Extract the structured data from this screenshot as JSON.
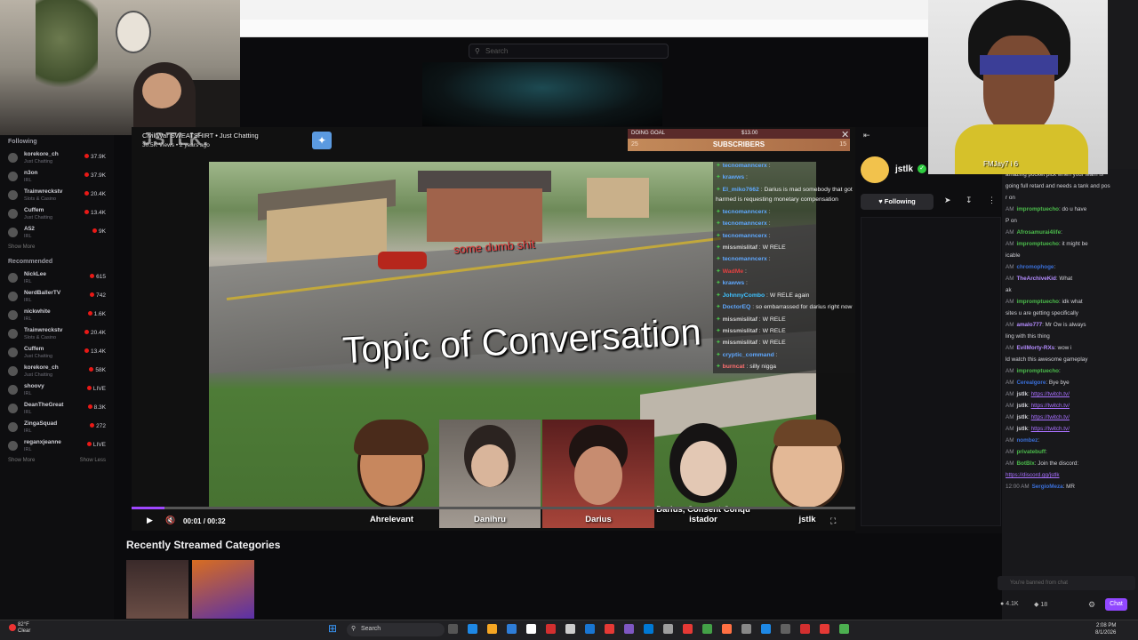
{
  "browser": {
    "search_placeholder": "Search"
  },
  "sidebar": {
    "following_header": "Following",
    "following": [
      {
        "name": "korekore_ch",
        "game": "Just Chatting",
        "count": "37.9K"
      },
      {
        "name": "n3on",
        "game": "IRL",
        "count": "37.9K"
      },
      {
        "name": "Trainwreckstv",
        "game": "Slots & Casino",
        "count": "20.4K"
      },
      {
        "name": "Cuffem",
        "game": "Just Chatting",
        "count": "13.4K"
      },
      {
        "name": "A52",
        "game": "IRL",
        "count": "9K"
      }
    ],
    "show_more": "Show More",
    "recommended_header": "Recommended",
    "recommended": [
      {
        "name": "NickLee",
        "game": "IRL",
        "count": "615"
      },
      {
        "name": "NerdBallerTV",
        "game": "IRL",
        "count": "742"
      },
      {
        "name": "nickwhite",
        "game": "IRL",
        "count": "1.6K"
      },
      {
        "name": "Trainwreckstv",
        "game": "Slots & Casino",
        "count": "20.4K"
      },
      {
        "name": "Cuffem",
        "game": "Just Chatting",
        "count": "13.4K"
      },
      {
        "name": "korekore_ch",
        "game": "Just Chatting",
        "count": "58K"
      },
      {
        "name": "shoovy",
        "game": "IRL",
        "count": "LIVE"
      },
      {
        "name": "DeanTheGreat",
        "game": "IRL",
        "count": "8.3K"
      },
      {
        "name": "ZingaSquad",
        "game": "IRL",
        "count": "272"
      },
      {
        "name": "reganxjeanne",
        "game": "IRL",
        "count": "LIVE"
      }
    ],
    "show_more_2": "Show More",
    "show_less": "Show Less"
  },
  "player": {
    "stream_title": "Civil War SWEATSHIRT • Just Chatting",
    "stream_views": "30.5K Views • 2 years ago",
    "watermark": "JSTLK.",
    "video_title": "Topic of Conversation",
    "video_subtitle": "some dumb shit",
    "elapsed": "00:01",
    "duration": "00:32",
    "progress": 0.045,
    "goal": {
      "label": "DOING GOAL",
      "amount": "$13.00",
      "bar": "SUBSCRIBERS",
      "left": "25",
      "right": "15"
    },
    "tiles": [
      {
        "label": "Ahrelevant"
      },
      {
        "label": "Danihru"
      },
      {
        "label": "Darius"
      },
      {
        "label": "Darius, Consent Conqu istador"
      },
      {
        "label": "jstlk"
      }
    ]
  },
  "overlay_chat": [
    {
      "user": "tecnomanncerx",
      "text": "",
      "color": "#5fa8ff"
    },
    {
      "user": "krawws",
      "text": "",
      "color": "#5fa8ff"
    },
    {
      "user": "El_miko7662",
      "text": "Darius is mad somebody that got harmed is requesting monetary compensation",
      "color": "#5fa8ff",
      "wrap": true
    },
    {
      "user": "tecnomanncerx",
      "text": "",
      "color": "#5fa8ff"
    },
    {
      "user": "tecnomanncerx",
      "text": "",
      "color": "#5fa8ff"
    },
    {
      "user": "tecnomanncerx",
      "text": "",
      "color": "#5fa8ff"
    },
    {
      "user": "missmislitaf",
      "text": "W RELE",
      "color": "#d0d0d0"
    },
    {
      "user": "tecnomanncerx",
      "text": "",
      "color": "#5fa8ff"
    },
    {
      "user": "WadMe",
      "text": "",
      "color": "#e24040"
    },
    {
      "user": "krawws",
      "text": "",
      "color": "#5fa8ff"
    },
    {
      "user": "JohnnyCombo",
      "text": "W RELE again",
      "color": "#3ec1ff"
    },
    {
      "user": "DoctorEQ",
      "text": "so embarrassed for darius right now",
      "color": "#5fa8ff",
      "wrap": true
    },
    {
      "user": "missmislitaf",
      "text": "W RELE",
      "color": "#d0d0d0"
    },
    {
      "user": "missmislitaf",
      "text": "W RELE",
      "color": "#d0d0d0"
    },
    {
      "user": "missmislitaf",
      "text": "W RELE",
      "color": "#d0d0d0"
    },
    {
      "user": "cryptic_command",
      "text": "",
      "color": "#5fa8ff"
    },
    {
      "user": "burncat",
      "text": "silly nigga",
      "color": "#ff7070"
    }
  ],
  "channel": {
    "name": "jstlk",
    "follow_label": "Following",
    "verified": "✓"
  },
  "cam2": {
    "caption": "FMJay7 i 6"
  },
  "right_chat": [
    {
      "time": "",
      "user": "",
      "text": "amazing pocket pick when your team is",
      "color": "#d0d0d6"
    },
    {
      "time": "",
      "user": "",
      "text": "going full retard and needs a tank and pos",
      "color": "#d0d0d6"
    },
    {
      "time": "",
      "user": "",
      "text": "r on",
      "color": "#d0d0d6"
    },
    {
      "time": "AM",
      "user": "impromptuecho",
      "text": "do u have",
      "color": "#4bbb4b"
    },
    {
      "time": "",
      "user": "",
      "text": "P on",
      "color": "#d0d0d6"
    },
    {
      "time": "AM",
      "user": "Afrosamurai4life",
      "text": "",
      "color": "#4bbb4b"
    },
    {
      "time": "AM",
      "user": "impromptuecho",
      "text": "it might be",
      "color": "#4bbb4b"
    },
    {
      "time": "",
      "user": "",
      "text": "icable",
      "color": "#d0d0d6"
    },
    {
      "time": "AM",
      "user": "chromophoge",
      "text": "",
      "color": "#3a6fd8"
    },
    {
      "time": "AM",
      "user": "TheArchiveKid",
      "text": "What",
      "color": "#b48cff"
    },
    {
      "time": "",
      "user": "",
      "text": "ak",
      "color": "#d0d0d6"
    },
    {
      "time": "AM",
      "user": "impromptuecho",
      "text": "idk what",
      "color": "#4bbb4b"
    },
    {
      "time": "",
      "user": "",
      "text": "sites u are getting specifically",
      "color": "#d0d0d6"
    },
    {
      "time": "AM",
      "user": "amalo777",
      "text": "Mr Ow is always",
      "color": "#b48cff"
    },
    {
      "time": "",
      "user": "",
      "text": "ling with this thing",
      "color": "#d0d0d6"
    },
    {
      "time": "AM",
      "user": "EvilMorty-RXs",
      "text": "wow i",
      "color": "#b48cff"
    },
    {
      "time": "",
      "user": "",
      "text": "ld watch this awesome gameplay",
      "color": "#d0d0d6"
    },
    {
      "time": "AM",
      "user": "impromptuecho",
      "text": "",
      "color": "#4bbb4b"
    },
    {
      "time": "AM",
      "user": "Cerealgore",
      "text": "Bye bye",
      "color": "#3a6fd8"
    },
    {
      "time": "AM",
      "user": "jstlk",
      "text": "https://twitch.tv/",
      "color": "#d0d0d6",
      "link": true
    },
    {
      "time": "AM",
      "user": "jstlk",
      "text": "https://twitch.tv/",
      "color": "#d0d0d6",
      "link": true
    },
    {
      "time": "AM",
      "user": "jstlk",
      "text": "https://twitch.tv/",
      "color": "#d0d0d6",
      "link": true
    },
    {
      "time": "AM",
      "user": "jstlk",
      "text": "https://twitch.tv/",
      "color": "#d0d0d6",
      "link": true
    },
    {
      "time": "AM",
      "user": "nombez",
      "text": "",
      "color": "#3a6fd8"
    },
    {
      "time": "AM",
      "user": "privatebuff",
      "text": "",
      "color": "#4bbb4b"
    },
    {
      "time": "AM",
      "user": "BotBlx",
      "text": "Join the discord:",
      "color": "#4bbb4b"
    },
    {
      "time": "",
      "user": "",
      "text": "https://discord.gg/jstlk",
      "color": "#d0d0d6",
      "link": true
    },
    {
      "time": "12:00 AM",
      "user": "SergioMeza",
      "text": "MR",
      "color": "#3a6fd8"
    }
  ],
  "chat_input_placeholder": "You're banned from chat",
  "chat_button": "Chat",
  "chat_stats": {
    "viewers": "4.1K",
    "points": "18"
  },
  "recently_streamed": "Recently Streamed Categories",
  "taskbar": {
    "weather_temp": "82°F",
    "weather_desc": "Clear",
    "search": "Search",
    "time": "2:08 PM",
    "date": "8/1/2026"
  },
  "colors": {
    "accent": "#9147ff",
    "live": "#e91916"
  }
}
